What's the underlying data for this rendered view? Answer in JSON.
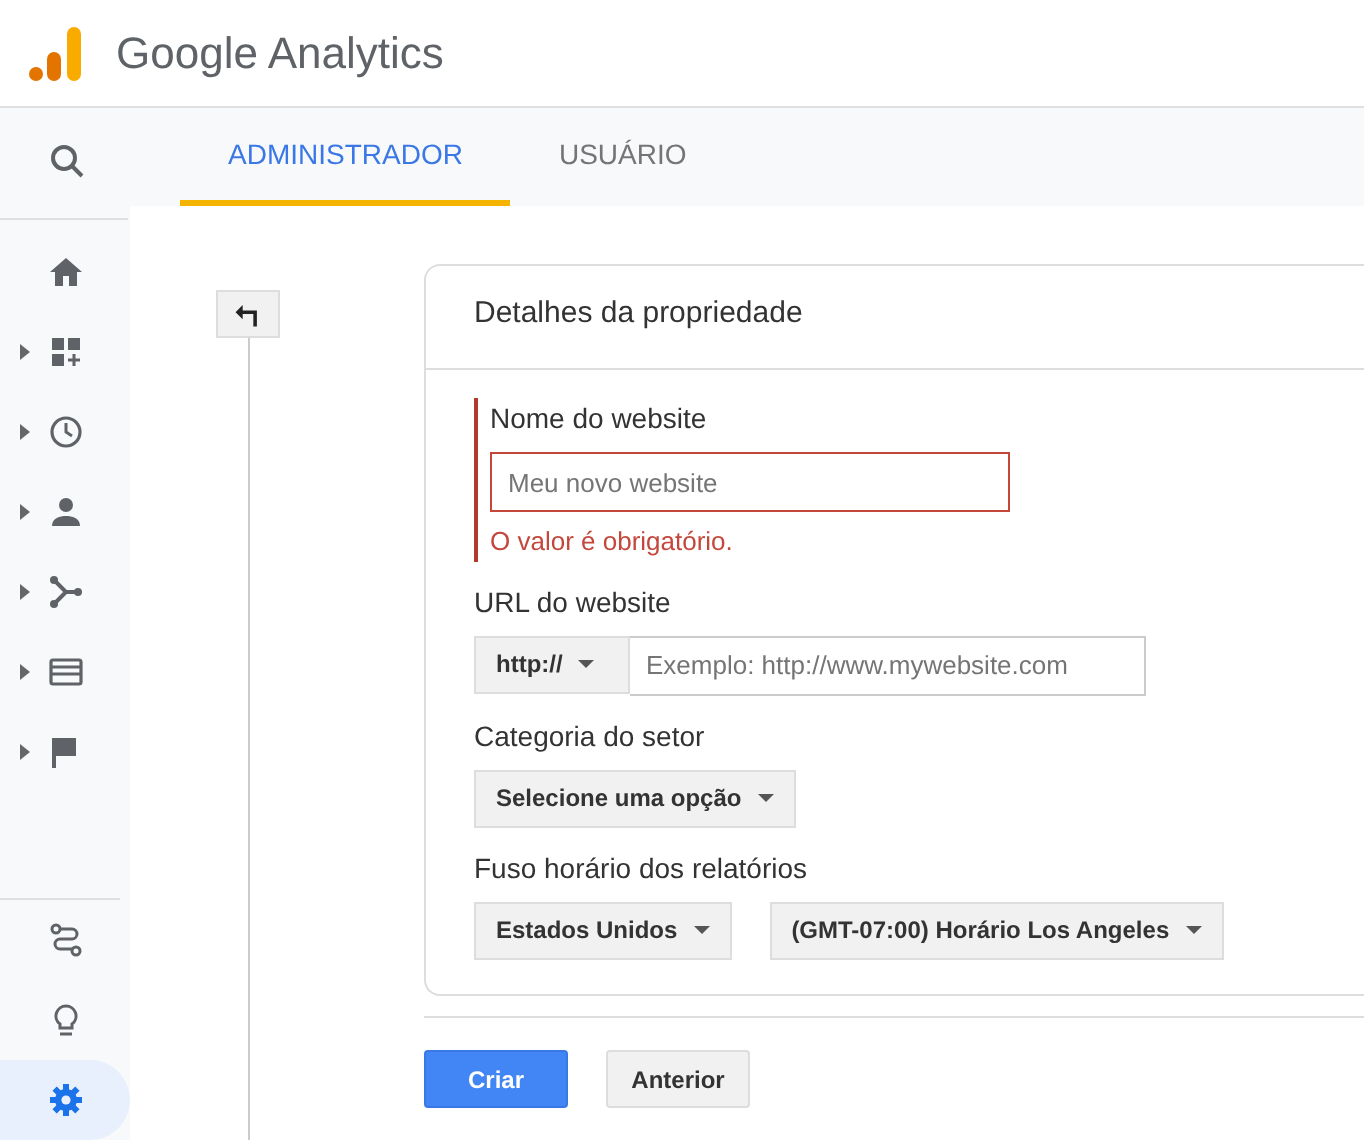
{
  "app": {
    "title": "Google Analytics"
  },
  "sidebar": {
    "items": [
      {
        "expandable": false,
        "selected": false
      },
      {
        "expandable": false,
        "selected": false
      },
      {
        "expandable": true,
        "selected": false
      },
      {
        "expandable": true,
        "selected": false
      },
      {
        "expandable": true,
        "selected": false
      },
      {
        "expandable": true,
        "selected": false
      },
      {
        "expandable": true,
        "selected": false
      },
      {
        "expandable": true,
        "selected": false
      }
    ],
    "bottom_items": [
      {
        "selected": false
      },
      {
        "selected": false
      },
      {
        "selected": true
      }
    ]
  },
  "tabs": [
    {
      "label": "ADMINISTRADOR",
      "selected": true
    },
    {
      "label": "USUÁRIO",
      "selected": false
    }
  ],
  "form": {
    "title": "Detalhes da propriedade",
    "fields": [
      {
        "kind": "text",
        "label": "Nome do website",
        "placeholder": "Meu novo website",
        "error": "O valor é obrigatório."
      },
      {
        "kind": "url",
        "label": "URL do website",
        "prefix": "http://",
        "placeholder": "Exemplo: http://www.mywebsite.com"
      },
      {
        "kind": "select",
        "label": "Categoria do setor",
        "options": [
          "Selecione uma opção"
        ]
      },
      {
        "kind": "select",
        "label": "Fuso horário dos relatórios",
        "options": [
          "Estados Unidos",
          "(GMT-07:00) Horário Los Angeles"
        ]
      }
    ]
  },
  "buttons": [
    {
      "label": "Criar",
      "primary": true
    },
    {
      "label": "Anterior",
      "primary": false
    }
  ]
}
